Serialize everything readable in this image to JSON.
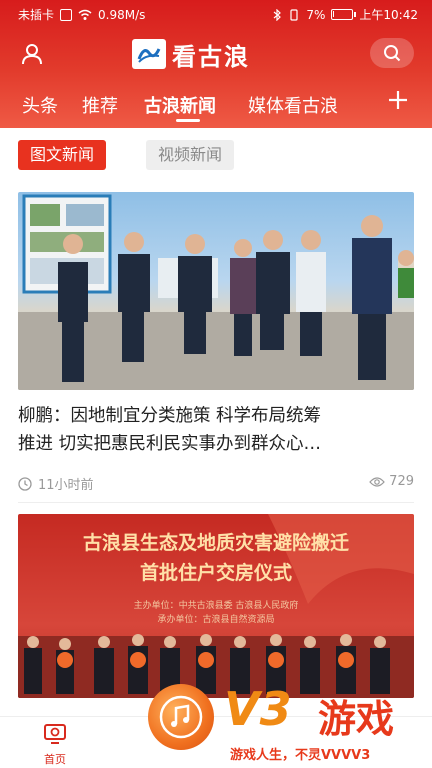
{
  "status_bar": {
    "carrier": "未插卡",
    "speed": "0.98M/s",
    "battery": "7%",
    "battery_level": 0.07,
    "time": "上午10:42"
  },
  "header": {
    "logo_text": "看古浪",
    "logo_icon": "gulang-logo-icon",
    "user_icon": "user-icon",
    "search_icon": "search-icon"
  },
  "tabs": {
    "items": [
      {
        "label": "头条",
        "active": false
      },
      {
        "label": "推荐",
        "active": false
      },
      {
        "label": "古浪新闻",
        "active": true
      },
      {
        "label": "媒体看古浪",
        "active": false
      }
    ],
    "add_icon": "plus-icon"
  },
  "subtabs": {
    "items": [
      {
        "label": "图文新闻",
        "active": true
      },
      {
        "label": "视频新闻",
        "active": false
      }
    ]
  },
  "feed": [
    {
      "headline_line1": "柳鹏：因地制宜分类施策 科学布局统筹",
      "headline_line2": "推进 切实把惠民利民实事办到群众心…",
      "time": "11小时前",
      "views": "729"
    },
    {
      "banner_line1": "古浪县生态及地质灾害避险搬迁",
      "banner_line2": "首批住户交房仪式",
      "banner_small1": "主办单位：中共古浪县委 古浪县人民政府",
      "banner_small2": "承办单位：古浪县自然资源局"
    }
  ],
  "bottom_nav": {
    "home_label": "首页",
    "home_icon": "home-tv-icon"
  },
  "watermark": {
    "brand": "V3",
    "name": "游戏",
    "slogan": "游戏人生，不灵VVVV3"
  },
  "colors": {
    "brand_red": "#e23b2c",
    "chip_active": "#e8321f",
    "watermark_orange": "#f08a14"
  }
}
